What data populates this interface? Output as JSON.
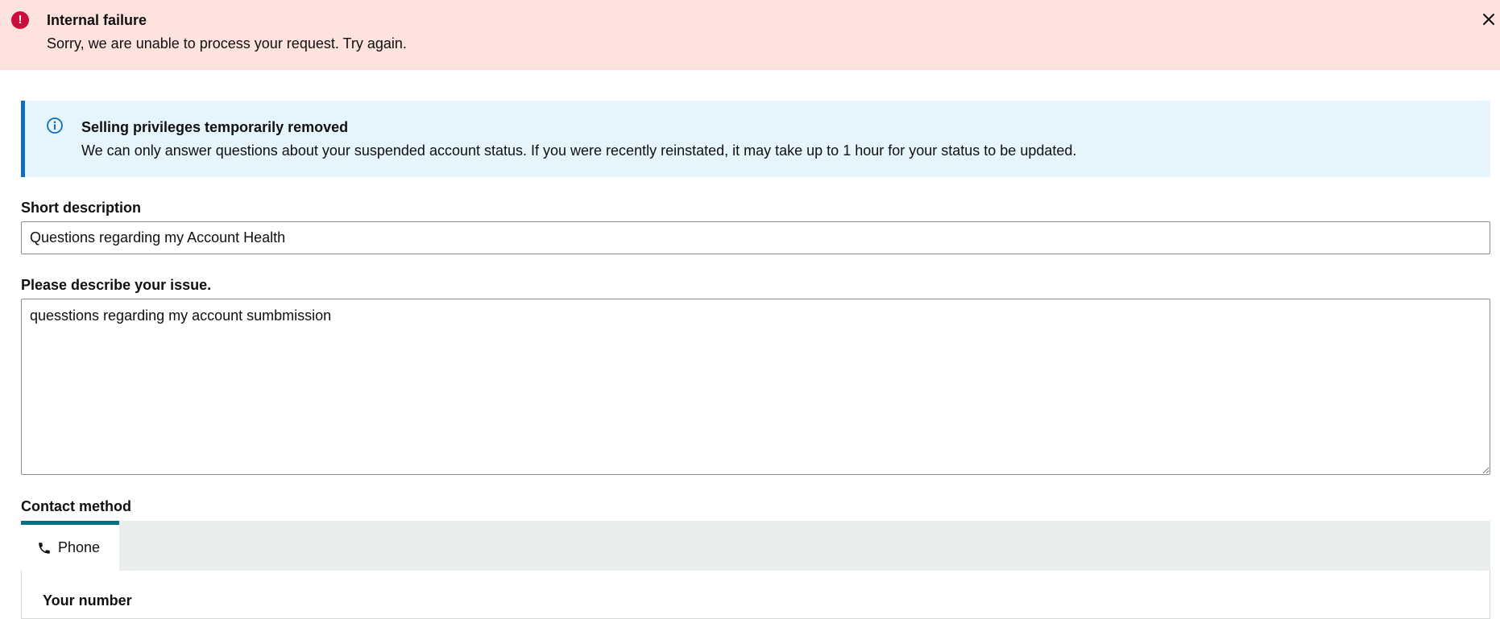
{
  "error_banner": {
    "title": "Internal failure",
    "message": "Sorry, we are unable to process your request. Try again.",
    "icon": "error-icon",
    "icon_glyph": "!",
    "color": "#fee2dd"
  },
  "info_alert": {
    "title": "Selling privileges temporarily removed",
    "message": "We can only answer questions about your suspended account status. If you were recently reinstated, it may take up to 1 hour for your status to be updated.",
    "icon": "info-icon",
    "accent": "#0f6dbd"
  },
  "form": {
    "short_description_label": "Short description",
    "short_description_value": "Questions regarding my Account Health",
    "issue_label": "Please describe your issue.",
    "issue_value": "quesstions regarding my account sumbmission",
    "contact_method_label": "Contact method",
    "tabs": [
      {
        "label": "Phone",
        "icon": "phone-icon",
        "selected": true
      }
    ],
    "your_number_label": "Your number"
  },
  "colors": {
    "tab_accent": "#007185",
    "error_icon": "#cc0c39"
  }
}
